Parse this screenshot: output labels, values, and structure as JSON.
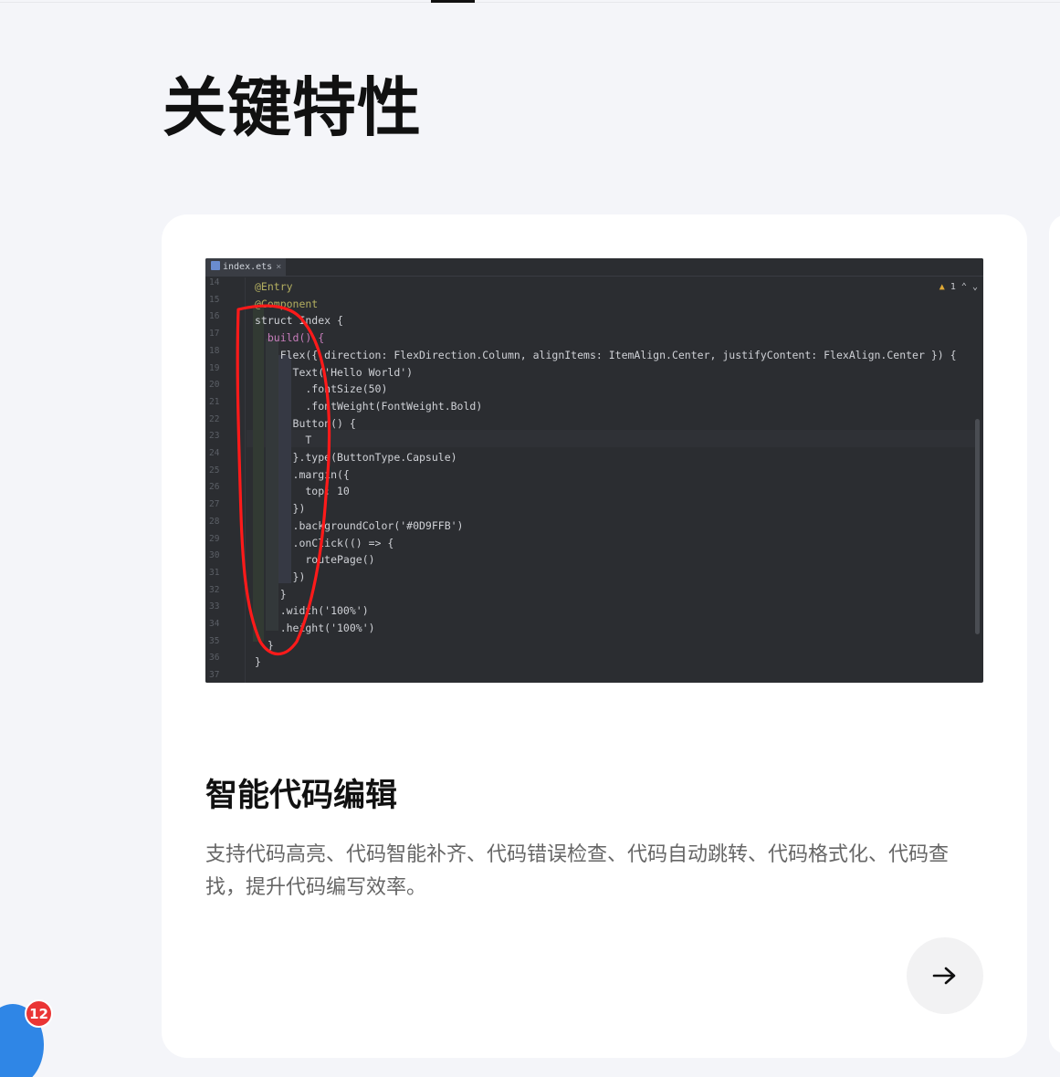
{
  "section": {
    "title": "关键特性"
  },
  "editor": {
    "tab_label": "index.ets",
    "tab_close": "×",
    "warning_count": "1",
    "line_numbers": [
      "14",
      "15",
      "16",
      "17",
      "18",
      "19",
      "20",
      "21",
      "22",
      "23",
      "24",
      "25",
      "26",
      "27",
      "28",
      "29",
      "30",
      "31",
      "32",
      "33",
      "34",
      "35",
      "36",
      "37"
    ],
    "code_lines": [
      "@Entry",
      "@Component",
      "struct Index {",
      "  build() {",
      "    Flex({ direction: FlexDirection.Column, alignItems: ItemAlign.Center, justifyContent: FlexAlign.Center }) {",
      "      Text('Hello World')",
      "        .fontSize(50)",
      "        .fontWeight(FontWeight.Bold)",
      "      Button() {",
      "        T",
      "      }.type(ButtonType.Capsule)",
      "      .margin({",
      "        top: 10",
      "      })",
      "      .backgroundColor('#0D9FFB')",
      "      .onClick(() => {",
      "        routePage()",
      "      })",
      "    }",
      "    .width('100%')",
      "    .height('100%')",
      "  }",
      "}",
      ""
    ]
  },
  "feature": {
    "title": "智能代码编辑",
    "description": "支持代码高亮、代码智能补齐、代码错误检查、代码自动跳转、代码格式化、代码查找，提升代码编写效率。"
  },
  "float_widget": {
    "badge_count": "12"
  },
  "colors": {
    "accent": "#111111",
    "badge": "#ea3535",
    "annotation": "#ff1a1a"
  }
}
